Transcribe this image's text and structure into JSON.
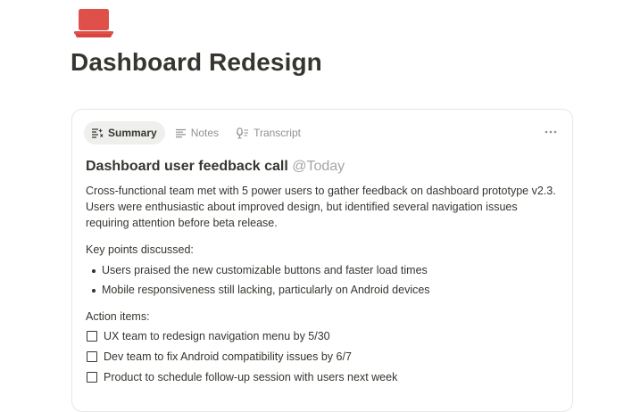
{
  "page": {
    "icon": "laptop-icon",
    "icon_color": "#e0504b",
    "title": "Dashboard Redesign"
  },
  "card": {
    "tabs": [
      {
        "label": "Summary",
        "icon": "summary-icon",
        "active": true
      },
      {
        "label": "Notes",
        "icon": "notes-icon",
        "active": false
      },
      {
        "label": "Transcript",
        "icon": "transcript-icon",
        "active": false
      }
    ],
    "more_icon": "more-icon",
    "summary": {
      "heading": "Dashboard user feedback call",
      "mention": "@Today",
      "text": "Cross-functional team met with 5 power users to gather feedback on dashboard prototype v2.3. Users were enthusiastic about improved design, but identified several navigation issues requiring attention before beta release.",
      "key_points_label": "Key points discussed:",
      "key_points": [
        "Users praised the new customizable buttons and faster load times",
        "Mobile responsiveness still lacking, particularly on Android devices"
      ],
      "action_items_label": "Action items:",
      "action_items": [
        {
          "text": "UX team to redesign navigation menu by 5/30",
          "checked": false
        },
        {
          "text": "Dev team to fix Android compatibility issues by 6/7",
          "checked": false
        },
        {
          "text": "Product to schedule follow-up session with users next week",
          "checked": false
        }
      ]
    }
  }
}
